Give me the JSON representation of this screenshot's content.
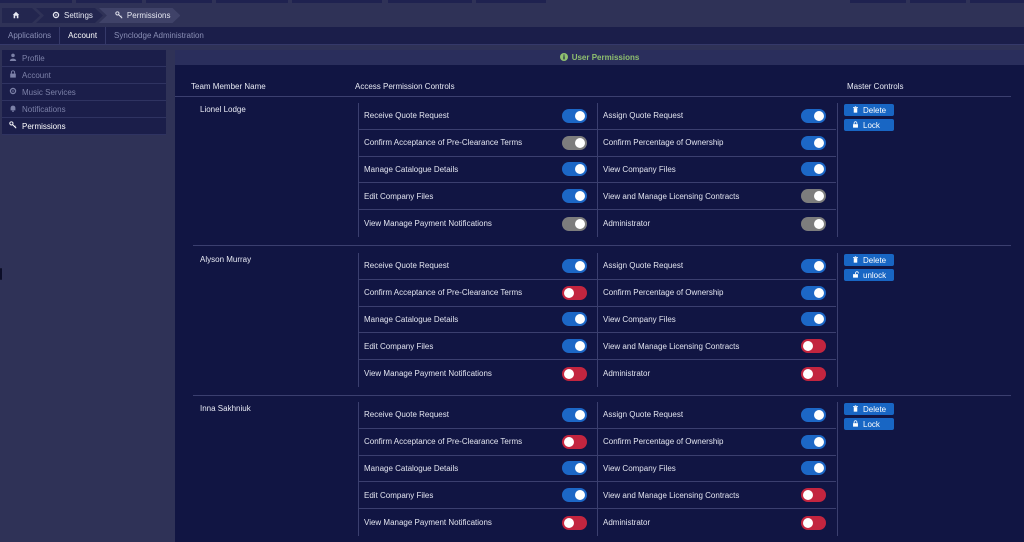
{
  "breadcrumb": {
    "home_icon": "home-icon",
    "items": [
      "Settings",
      "Permissions"
    ]
  },
  "tabs": [
    "Applications",
    "Account",
    "Synclodge Administration"
  ],
  "sidebar": {
    "items": [
      "Profile",
      "Account",
      "Music Services",
      "Notifications",
      "Permissions"
    ]
  },
  "panel": {
    "title": "User Permissions"
  },
  "columns": {
    "member": "Team Member Name",
    "access": "Access Permission Controls",
    "master": "Master Controls"
  },
  "colors": {
    "on": "#1c67c6",
    "off": "#c3253f",
    "disabled": "#7d7d7d",
    "button": "#1866c4"
  },
  "members": [
    {
      "name": "Lionel Lodge",
      "left": [
        {
          "label": "Receive Quote Request",
          "state": "on"
        },
        {
          "label": "Confirm Acceptance of Pre-Clearance Terms",
          "state": "disabled"
        },
        {
          "label": "Manage Catalogue Details",
          "state": "on"
        },
        {
          "label": "Edit Company Files",
          "state": "on"
        },
        {
          "label": "View Manage Payment Notifications",
          "state": "disabled"
        }
      ],
      "right": [
        {
          "label": "Assign Quote Request",
          "state": "on"
        },
        {
          "label": "Confirm Percentage of Ownership",
          "state": "on"
        },
        {
          "label": "View Company Files",
          "state": "on"
        },
        {
          "label": "View and Manage Licensing Contracts",
          "state": "disabled"
        },
        {
          "label": "Administrator",
          "state": "disabled"
        }
      ],
      "buttons": {
        "delete": "Delete",
        "lock": "Lock"
      }
    },
    {
      "name": "Alyson Murray",
      "left": [
        {
          "label": "Receive Quote Request",
          "state": "on"
        },
        {
          "label": "Confirm Acceptance of Pre-Clearance Terms",
          "state": "off"
        },
        {
          "label": "Manage Catalogue Details",
          "state": "on"
        },
        {
          "label": "Edit Company Files",
          "state": "on"
        },
        {
          "label": "View Manage Payment Notifications",
          "state": "off"
        }
      ],
      "right": [
        {
          "label": "Assign Quote Request",
          "state": "on"
        },
        {
          "label": "Confirm Percentage of Ownership",
          "state": "on"
        },
        {
          "label": "View Company Files",
          "state": "on"
        },
        {
          "label": "View and Manage Licensing Contracts",
          "state": "off"
        },
        {
          "label": "Administrator",
          "state": "off"
        }
      ],
      "buttons": {
        "delete": "Delete",
        "lock": "unlock"
      }
    },
    {
      "name": "Inna Sakhniuk",
      "left": [
        {
          "label": "Receive Quote Request",
          "state": "on"
        },
        {
          "label": "Confirm Acceptance of Pre-Clearance Terms",
          "state": "off"
        },
        {
          "label": "Manage Catalogue Details",
          "state": "on"
        },
        {
          "label": "Edit Company Files",
          "state": "on"
        },
        {
          "label": "View Manage Payment Notifications",
          "state": "off"
        }
      ],
      "right": [
        {
          "label": "Assign Quote Request",
          "state": "on"
        },
        {
          "label": "Confirm Percentage of Ownership",
          "state": "on"
        },
        {
          "label": "View Company Files",
          "state": "on"
        },
        {
          "label": "View and Manage Licensing Contracts",
          "state": "off"
        },
        {
          "label": "Administrator",
          "state": "off"
        }
      ],
      "buttons": {
        "delete": "Delete",
        "lock": "Lock"
      }
    }
  ]
}
